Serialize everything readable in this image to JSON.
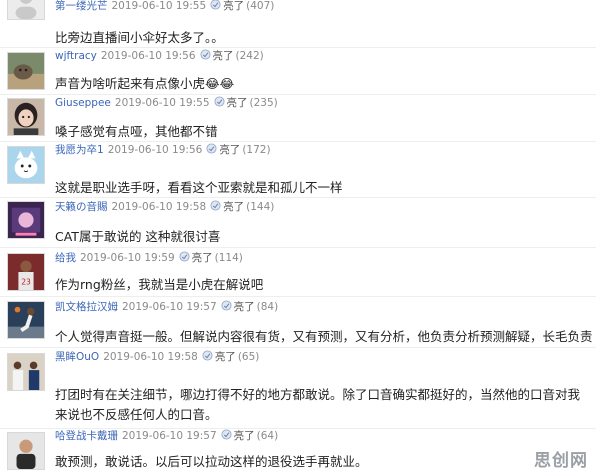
{
  "comments": [
    {
      "user": "第一缕光芒",
      "date": "2019-06-10 19:55",
      "like": "亮了",
      "count": "(407)",
      "text": "比旁边直播间小伞好太多了。。",
      "avatar_icon": "default-avatar-icon"
    },
    {
      "user": "wjftracy",
      "date": "2019-06-10 19:56",
      "like": "亮了",
      "count": "(242)",
      "text": "声音为啥听起来有点像小虎😂😂",
      "avatar_icon": "cat-photo-avatar-icon"
    },
    {
      "user": "Giuseppee",
      "date": "2019-06-10 19:55",
      "like": "亮了",
      "count": "(235)",
      "text": "嗓子感觉有点哑，其他都不错",
      "avatar_icon": "girl-photo-avatar-icon"
    },
    {
      "user": "我愿为卒1",
      "date": "2019-06-10 19:56",
      "like": "亮了",
      "count": "(172)",
      "text": "这就是职业选手呀，看看这个亚索就是和孤儿不一样",
      "avatar_icon": "cartoon-cat-avatar-icon"
    },
    {
      "user": "天籁の音賜",
      "date": "2019-06-10 19:58",
      "like": "亮了",
      "count": "(144)",
      "text": "CAT属于敢说的 这种就很讨喜",
      "avatar_icon": "anime-avatar-icon"
    },
    {
      "user": "给我",
      "date": "2019-06-10 19:59",
      "like": "亮了",
      "count": "(114)",
      "text": "作为rng粉丝，我就当是小虎在解说吧",
      "avatar_icon": "basketball-player-avatar-icon"
    },
    {
      "user": "凯文格拉汉姆",
      "date": "2019-06-10 19:57",
      "like": "亮了",
      "count": "(84)",
      "text": "个人觉得声音挺一般。但解说内容很有货，又有预测，又有分析，他负责分析预测解疑，长毛负责团战",
      "avatar_icon": "dunk-photo-avatar-icon"
    },
    {
      "user": "黑眸OuO",
      "date": "2019-06-10 19:58",
      "like": "亮了",
      "count": "(65)",
      "text": "打团时有在关注细节，哪边打得不好的地方都敢说。除了口音确实都挺好的，当然他的口音对我来说也不反感任何人的口音。",
      "avatar_icon": "team-photo-avatar-icon"
    },
    {
      "user": "哈登战卡戴珊",
      "date": "2019-06-10 19:57",
      "like": "亮了",
      "count": "(64)",
      "text": "敢预测，敢说话。以后可以拉动这样的退役选手再就业。",
      "avatar_icon": "man-photo-avatar-icon"
    }
  ],
  "watermark": "思创网",
  "colors": {
    "username": "#3b66b8",
    "meta": "#8a8a8a",
    "text": "#222222"
  }
}
